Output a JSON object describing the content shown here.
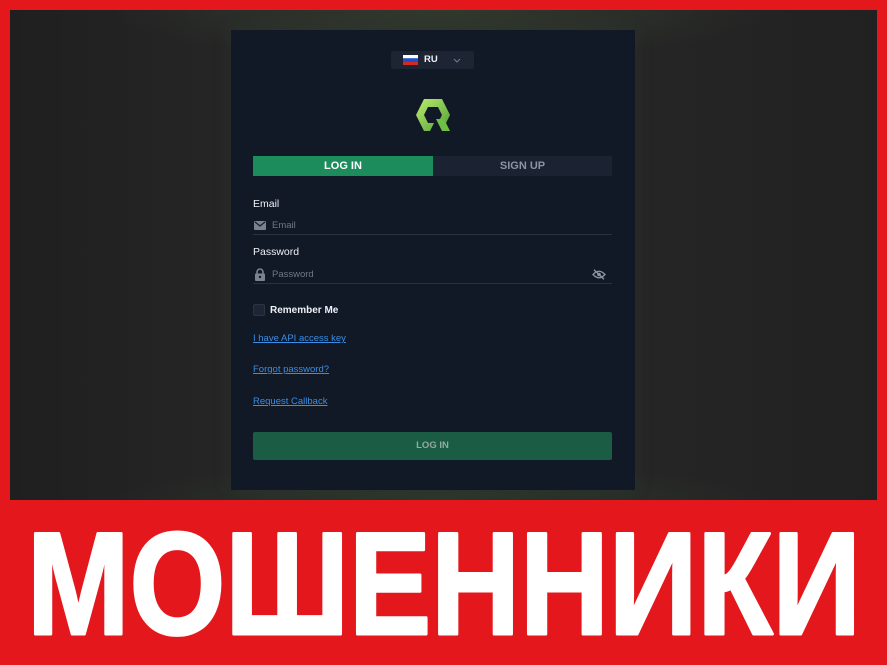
{
  "language_selector": {
    "code": "RU",
    "flag_icon": "russia-flag-icon",
    "chevron_icon": "chevron-down-icon"
  },
  "logo": {
    "icon": "brand-logo-icon",
    "color": "#8dd14f"
  },
  "tabs": [
    {
      "label": "LOG IN",
      "active": true
    },
    {
      "label": "SIGN UP",
      "active": false
    }
  ],
  "form": {
    "email": {
      "label": "Email",
      "placeholder": "Email",
      "icon": "envelope-icon"
    },
    "password": {
      "label": "Password",
      "placeholder": "Password",
      "icon": "lock-icon",
      "toggle_icon": "eye-slash-icon"
    },
    "remember_me": {
      "label": "Remember Me",
      "checked": false
    }
  },
  "links": [
    {
      "label": "I have API access key"
    },
    {
      "label": "Forgot password?"
    },
    {
      "label": "Request Callback"
    }
  ],
  "submit": {
    "label": "LOG IN"
  },
  "banner": {
    "text": "МОШЕННИКИ"
  },
  "colors": {
    "frame_red": "#e4181c",
    "panel": "#111826",
    "accent_green": "#1c8c5c",
    "submit_green": "#1a5c44",
    "link_blue": "#3a8ee6",
    "banner_text": "#ffffff"
  }
}
